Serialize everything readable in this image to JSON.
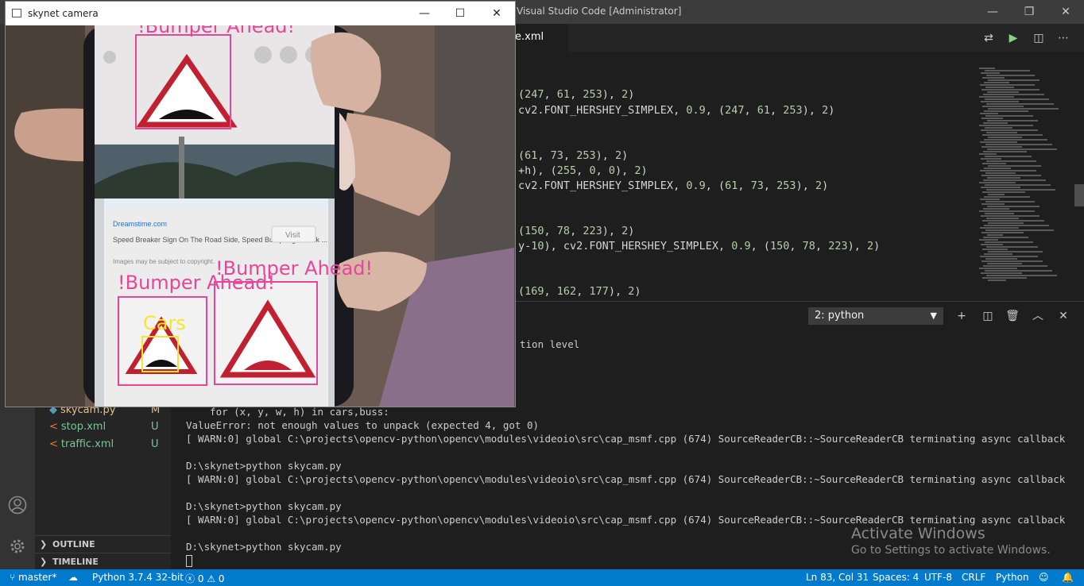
{
  "vscode": {
    "window_title": "Visual Studio Code [Administrator]",
    "tab_label": "e.xml",
    "code_lines": [
      "(247, 61, 253), 2)",
      "cv2.FONT_HERSHEY_SIMPLEX, 0.9, (247, 61, 253), 2)",
      "(61, 73, 253), 2)",
      "+h), (255, 0, 0), 2)",
      "cv2.FONT_HERSHEY_SIMPLEX, 0.9, (61, 73, 253), 2)",
      "(150, 78, 223), 2)",
      "y-10), cv2.FONT_HERSHEY_SIMPLEX, 0.9, (150, 78, 223), 2)",
      "(169, 162, 177), 2)"
    ],
    "sidebar": {
      "files": [
        {
          "name": "skycam.py",
          "status": "M"
        },
        {
          "name": "stop.xml",
          "status": "U"
        },
        {
          "name": "traffic.xml",
          "status": "U"
        }
      ],
      "outline_label": "OUTLINE",
      "timeline_label": "TIMELINE"
    },
    "panel": {
      "terminal_selected": "2: python",
      "lines": [
        "tion level",
        "  for (x, y, w, h) in cars,buss:",
        "ValueError: not enough values to unpack (expected 4, got 0)",
        "[ WARN:0] global C:\\projects\\opencv-python\\opencv\\modules\\videoio\\src\\cap_msmf.cpp (674) SourceReaderCB::~SourceReaderCB terminating async callback",
        "",
        "D:\\skynet>python skycam.py",
        "[ WARN:0] global C:\\projects\\opencv-python\\opencv\\modules\\videoio\\src\\cap_msmf.cpp (674) SourceReaderCB::~SourceReaderCB terminating async callback",
        "",
        "D:\\skynet>python skycam.py",
        "[ WARN:0] global C:\\projects\\opencv-python\\opencv\\modules\\videoio\\src\\cap_msmf.cpp (674) SourceReaderCB::~SourceReaderCB terminating async callback",
        "",
        "D:\\skynet>python skycam.py"
      ]
    },
    "watermark": {
      "line1": "Activate Windows",
      "line2": "Go to Settings to activate Windows."
    },
    "statusbar": {
      "branch": "master*",
      "interpreter": "Python 3.7.4 32-bit",
      "errors": "0",
      "warnings": "0",
      "position": "Ln 83, Col 31",
      "spaces": "Spaces: 4",
      "encoding": "UTF-8",
      "eol": "CRLF",
      "language": "Python"
    }
  },
  "camera": {
    "window_title": "skynet camera",
    "detections": [
      {
        "label": "!Bumper Ahead!",
        "color": "#e6469a"
      },
      {
        "label": "!Bumper Ahead!",
        "color": "#e6469a"
      },
      {
        "label": "!Bumper Ahead!",
        "color": "#e6469a"
      },
      {
        "label": "Cars",
        "color": "#f5e62a"
      }
    ],
    "phone_text": {
      "site": "Dreamstime.com",
      "caption": "Speed Breaker Sign On The Road Side, Speed Bump Sign Stock ...",
      "note": "Images may be subject to copyright.",
      "visit": "Visit"
    }
  }
}
